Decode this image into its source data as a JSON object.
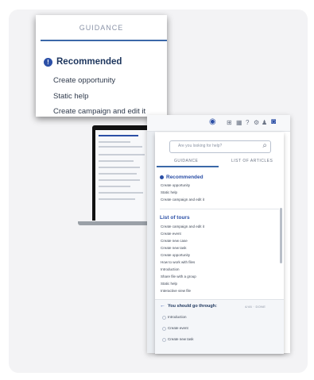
{
  "callout": {
    "tab_label": "GUIDANCE",
    "section_title": "Recommended",
    "items": [
      "Create opportunity",
      "Static help",
      "Create campaign and edit it"
    ]
  },
  "panel": {
    "search_placeholder": "Are you looking for help?",
    "tabs": [
      "GUIDANCE",
      "LIST OF ARTICLES"
    ],
    "recommended": {
      "title": "Recommended",
      "items": [
        "Create opportunity",
        "Static help",
        "Create campaign and edit it"
      ]
    },
    "tours": {
      "title": "List of tours",
      "items": [
        "Create campaign and edit it",
        "Create event",
        "Create new case",
        "Create new task",
        "Create opportunity",
        "How to work with files",
        "Introduction",
        "Share file with a group",
        "Static help",
        "Interactive view file"
      ]
    },
    "footer": {
      "title": "You should go through:",
      "meta": "4/46 · DONE",
      "items": [
        "Introduction",
        "Create event",
        "Create new task"
      ]
    }
  },
  "colors": {
    "accent": "#2b4fa6",
    "heading": "#1c355d"
  }
}
